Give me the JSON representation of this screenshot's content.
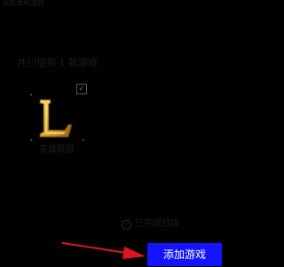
{
  "window": {
    "title": "添加本地游戏"
  },
  "scan": {
    "summary": "共扫描到 1 款游戏"
  },
  "games": [
    {
      "name": "英雄联盟",
      "checked": true,
      "check_glyph": "✓",
      "icon": "league-of-legends-logo-icon"
    }
  ],
  "status": {
    "icon": "check-circle-icon",
    "glyph": "✓",
    "text": "已完成扫描"
  },
  "actions": {
    "add_label": "添加游戏"
  },
  "colors": {
    "background": "#000000",
    "button": "#1414ff",
    "button_text": "#ffffff",
    "annotation_arrow": "#e0141e"
  }
}
